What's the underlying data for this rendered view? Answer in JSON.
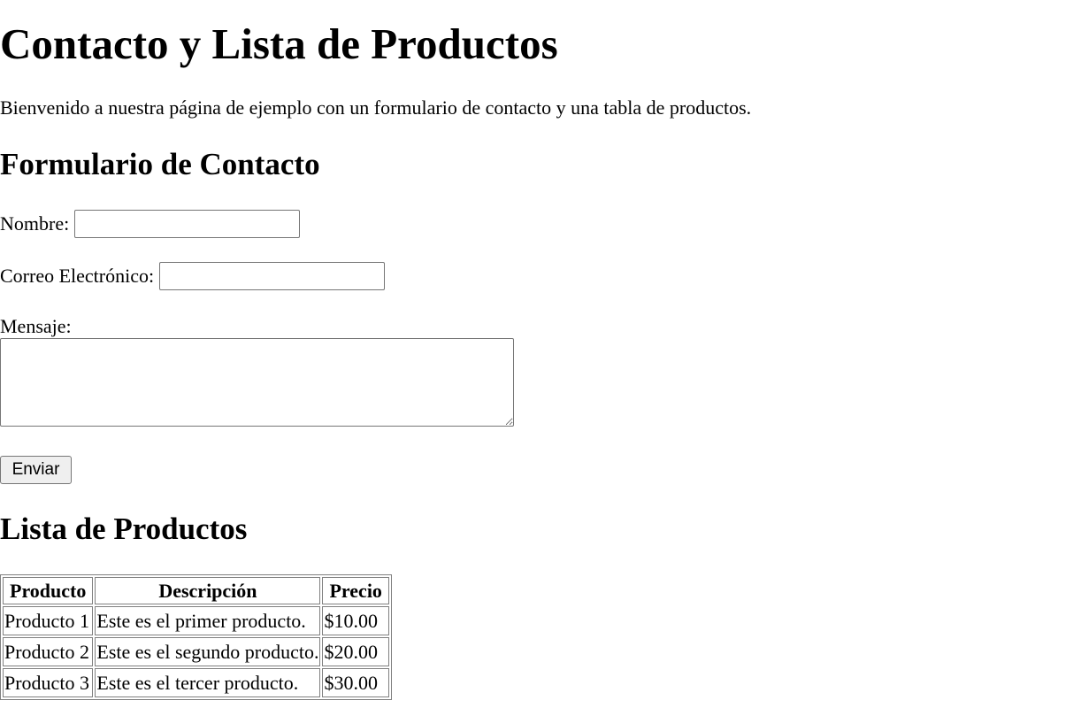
{
  "page": {
    "title": "Contacto y Lista de Productos",
    "intro": "Bienvenido a nuestra página de ejemplo con un formulario de contacto y una tabla de productos."
  },
  "contact_form": {
    "heading": "Formulario de Contacto",
    "name_label": "Nombre:",
    "name_value": "",
    "email_label": "Correo Electrónico:",
    "email_value": "",
    "message_label": "Mensaje:",
    "message_value": "",
    "submit_label": "Enviar"
  },
  "products": {
    "heading": "Lista de Productos",
    "columns": [
      "Producto",
      "Descripción",
      "Precio"
    ],
    "rows": [
      [
        "Producto 1",
        "Este es el primer producto.",
        "$10.00"
      ],
      [
        "Producto 2",
        "Este es el segundo producto.",
        "$20.00"
      ],
      [
        "Producto 3",
        "Este es el tercer producto.",
        "$30.00"
      ]
    ]
  }
}
